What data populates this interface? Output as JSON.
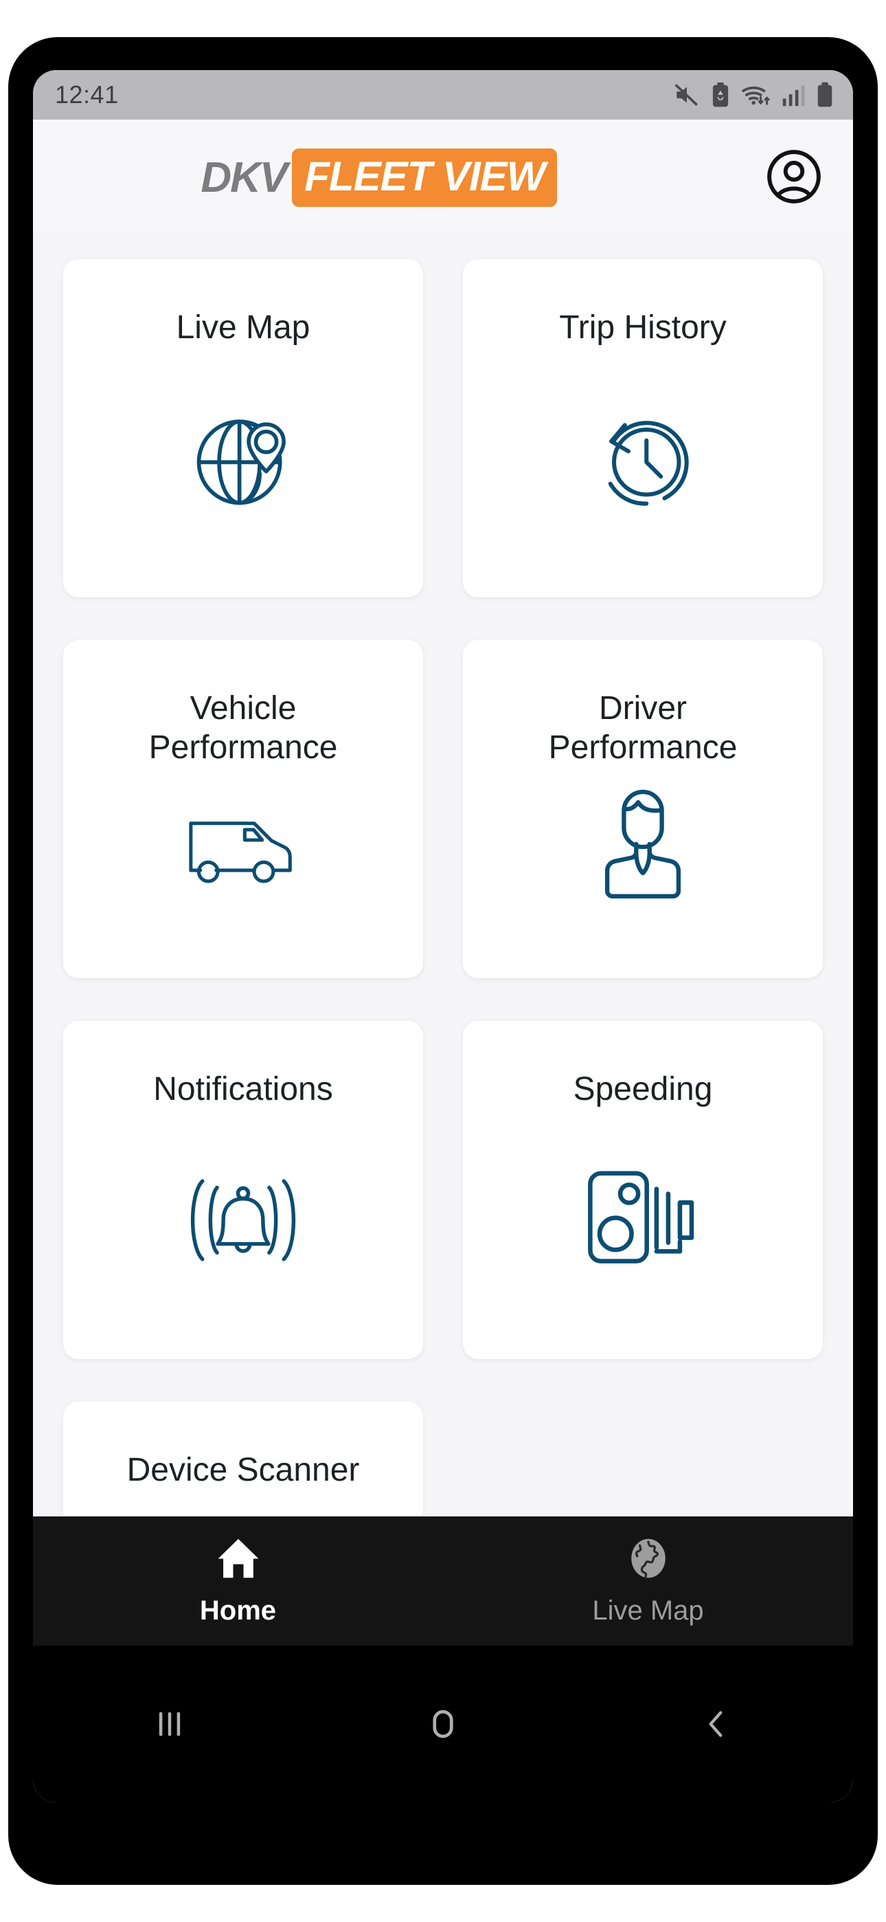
{
  "status_bar": {
    "time": "12:41",
    "icons": [
      "mute-icon",
      "battery-saver-icon",
      "wifi-icon",
      "cellular-signal-icon",
      "battery-icon"
    ]
  },
  "header": {
    "logo_primary": "DKV",
    "logo_secondary": "FLEET VIEW",
    "account_icon": "account-circle-icon",
    "brand_orange": "#f28b31",
    "brand_gray": "#7d7d7d"
  },
  "tiles": [
    {
      "label": "Live Map",
      "icon": "globe-pin-icon"
    },
    {
      "label": "Trip History",
      "icon": "clock-history-icon"
    },
    {
      "label": "Vehicle\nPerformance",
      "icon": "van-icon"
    },
    {
      "label": "Driver\nPerformance",
      "icon": "driver-person-icon"
    },
    {
      "label": "Notifications",
      "icon": "ringing-bell-icon"
    },
    {
      "label": "Speeding",
      "icon": "speed-camera-icon"
    },
    {
      "label": "Device Scanner",
      "icon": "scanner-icon"
    }
  ],
  "tile_icon_color": "#0d4d72",
  "bottom_nav": {
    "items": [
      {
        "label": "Home",
        "icon": "home-icon",
        "active": true
      },
      {
        "label": "Live Map",
        "icon": "globe-icon",
        "active": false
      }
    ]
  },
  "system_nav": {
    "recents": "recents-icon",
    "home": "home-circle-icon",
    "back": "back-chevron-icon"
  }
}
